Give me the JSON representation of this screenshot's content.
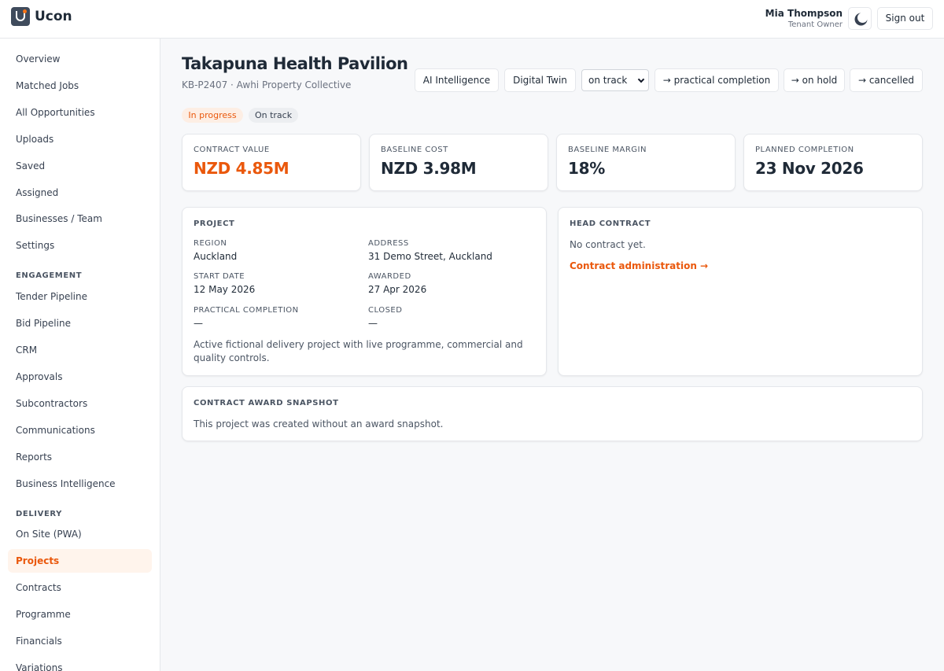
{
  "app": {
    "name": "Ucon"
  },
  "user": {
    "name": "Mia Thompson",
    "role": "Tenant Owner"
  },
  "header": {
    "sign_out_label": "Sign out"
  },
  "sidebar": {
    "items": [
      "Overview",
      "Matched Jobs",
      "All Opportunities",
      "Uploads",
      "Saved",
      "Assigned",
      "Businesses / Team",
      "Settings"
    ],
    "engagement_label": "ENGAGEMENT",
    "engagement": [
      "Tender Pipeline",
      "Bid Pipeline",
      "CRM",
      "Approvals",
      "Subcontractors",
      "Communications",
      "Reports",
      "Business Intelligence"
    ],
    "delivery_label": "DELIVERY",
    "delivery": [
      "On Site (PWA)",
      "Projects",
      "Contracts",
      "Programme",
      "Financials",
      "Variations"
    ],
    "active": "Projects"
  },
  "project": {
    "title": "Takapuna Health Pavilion",
    "subtitle": "KB-P2407 · Awhi Property Collective",
    "status_badge": "In progress",
    "health_badge": "On track",
    "status_select_value": "on track"
  },
  "toolbar": {
    "ai_label": "AI Intelligence",
    "twin_label": "Digital Twin",
    "practical_label": "→ practical completion",
    "hold_label": "→ on hold",
    "cancel_label": "→ cancelled"
  },
  "stats": [
    {
      "label": "CONTRACT VALUE",
      "value": "NZD 4.85M"
    },
    {
      "label": "BASELINE COST",
      "value": "NZD 3.98M"
    },
    {
      "label": "BASELINE MARGIN",
      "value": "18%"
    },
    {
      "label": "PLANNED COMPLETION",
      "value": "23 Nov 2026"
    }
  ],
  "project_card": {
    "heading": "PROJECT",
    "region_label": "REGION",
    "region": "Auckland",
    "address_label": "ADDRESS",
    "address": "31 Demo Street, Auckland",
    "start_label": "START DATE",
    "start": "12 May 2026",
    "awarded_label": "AWARDED",
    "awarded": "27 Apr 2026",
    "practical_label": "PRACTICAL COMPLETION",
    "practical": "—",
    "closed_label": "CLOSED",
    "closed": "—",
    "description": "Active fictional delivery project with live programme, commercial and quality controls."
  },
  "head_contract": {
    "heading": "HEAD CONTRACT",
    "empty_text": "No contract yet.",
    "link_label": "Contract administration →"
  },
  "award_snapshot": {
    "heading": "CONTRACT AWARD SNAPSHOT",
    "text": "This project was created without an award snapshot."
  }
}
